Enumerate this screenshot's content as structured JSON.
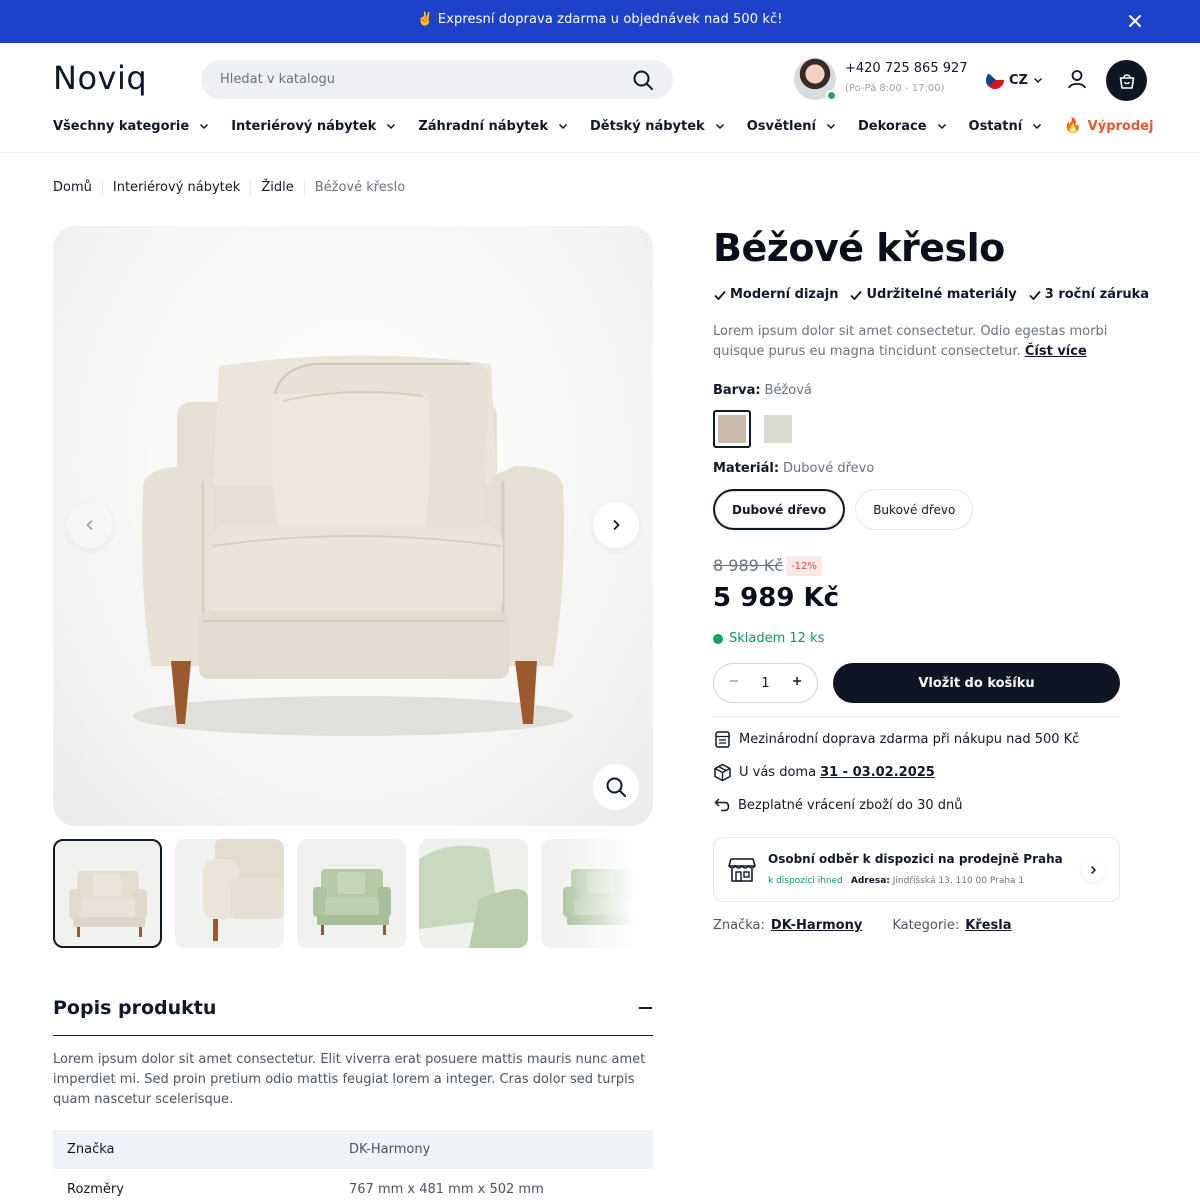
{
  "announcement": {
    "text": "✌️ Expresní doprava zdarma u objednávek nad 500 kč!"
  },
  "header": {
    "logo": "Noviq",
    "search_placeholder": "Hledat v katalogu",
    "phone": "+420 725 865 927",
    "hours": "(Po-Pá 8:00 - 17:00)",
    "language": "CZ"
  },
  "nav": {
    "items": [
      {
        "label": "Všechny kategorie"
      },
      {
        "label": "Interiérový nábytek"
      },
      {
        "label": "Záhradní nábytek"
      },
      {
        "label": "Dětský nábytek"
      },
      {
        "label": "Osvětlení"
      },
      {
        "label": "Dekorace"
      },
      {
        "label": "Ostatní"
      }
    ],
    "sale": "Výprodej"
  },
  "breadcrumb": [
    "Domů",
    "Interiérový nábytek",
    "Židle",
    "Béžové křeslo"
  ],
  "product": {
    "title": "Béžové křeslo",
    "features": [
      "Moderní dizajn",
      "Udržitelné materiály",
      "3 roční záruka"
    ],
    "description": "Lorem ipsum dolor sit amet consectetur. Odio egestas morbi quisque purus eu magna tincidunt consectetur.",
    "read_more": "Číst více",
    "color_label": "Barva:",
    "color_value": "Béžová",
    "swatches": [
      "#c9bcad",
      "#d9dbd3"
    ],
    "material_label": "Materiál:",
    "material_value": "Dubové dřevo",
    "materials": [
      "Dubové dřevo",
      "Bukové dřevo"
    ],
    "old_price": "8 989 Kč",
    "discount": "-12%",
    "price": "5 989 Kč",
    "stock": "Skladem 12 ks",
    "quantity": "1",
    "add_to_cart": "Vložit do košíku",
    "shipping_info": "Mezinárodní doprava zdarma při nákupu nad 500 Kč",
    "delivery_prefix": "U vás doma",
    "delivery_date": "31 - 03.02.2025",
    "returns": "Bezplatné vrácení zboží do 30 dnů",
    "pickup": {
      "title": "Osobní odběr k dispozici na prodejně Praha",
      "availability": "k dispozici ihned",
      "address_label": "Adresa:",
      "address": "Jindřišská 13, 110 00 Praha 1"
    },
    "brand_label": "Značka:",
    "brand": "DK-Harmony",
    "category_label": "Kategorie:",
    "category": "Křesla"
  },
  "description_section": {
    "title": "Popis produktu",
    "text": "Lorem ipsum dolor sit amet consectetur. Elit viverra erat posuere mattis mauris nunc amet imperdiet mi. Sed proin pretium odio mattis feugiat lorem a integer. Cras dolor sed turpis quam nascetur scelerisque.",
    "specs": [
      {
        "key": "Značka",
        "value": "DK-Harmony"
      },
      {
        "key": "Rozměry",
        "value": "767 mm x 481 mm x 502 mm"
      }
    ]
  },
  "colors": {
    "accent": "#1d41c9",
    "dark": "#0f1623",
    "stock_green": "#14955a",
    "sale": "#e4572e"
  }
}
